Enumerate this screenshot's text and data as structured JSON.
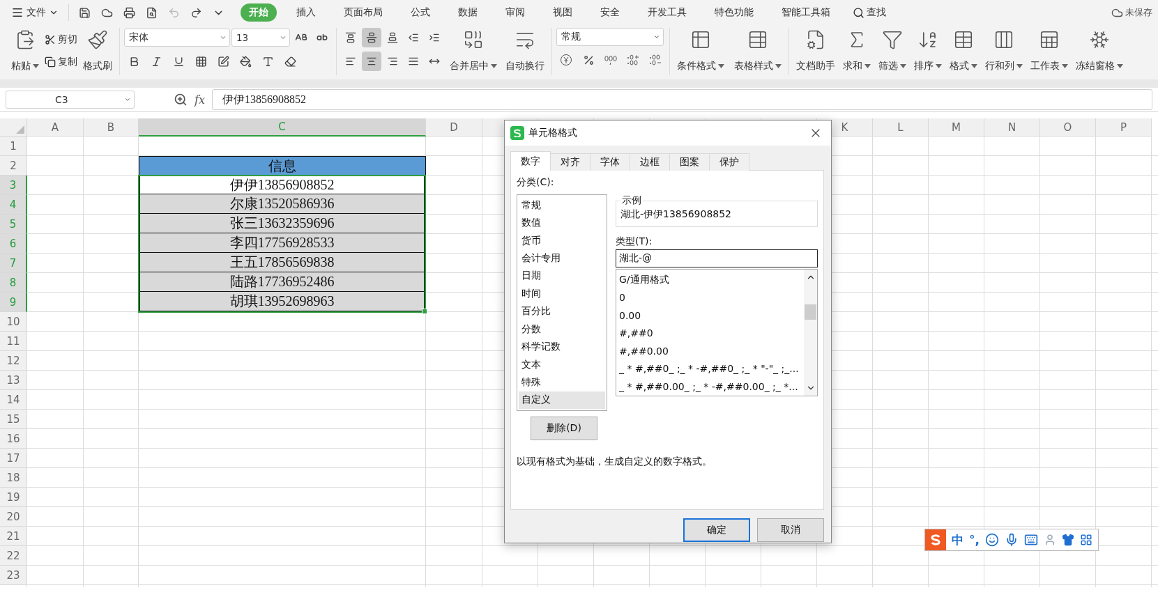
{
  "menu_bar": {
    "file_menu": "文件",
    "tabs": [
      {
        "label": "开始",
        "selected": true
      },
      {
        "label": "插入",
        "selected": false
      },
      {
        "label": "页面布局",
        "selected": false
      },
      {
        "label": "公式",
        "selected": false
      },
      {
        "label": "数据",
        "selected": false
      },
      {
        "label": "审阅",
        "selected": false
      },
      {
        "label": "视图",
        "selected": false
      },
      {
        "label": "安全",
        "selected": false
      },
      {
        "label": "开发工具",
        "selected": false
      },
      {
        "label": "特色功能",
        "selected": false
      },
      {
        "label": "智能工具箱",
        "selected": false
      }
    ],
    "search": "查找",
    "save_status": "未保存"
  },
  "ribbon": {
    "clipboard": [
      {
        "label": "粘贴",
        "kind": "large",
        "dropdown": true
      },
      {
        "label": "剪切",
        "kind": "small"
      },
      {
        "label": "复制",
        "kind": "small"
      },
      {
        "label": "格式刷",
        "kind": "large",
        "dropdown": false
      }
    ],
    "font_name": "宋体",
    "font_size": "13",
    "align_buttons": [
      {
        "selected": false
      },
      {
        "selected": true
      },
      {
        "selected": false
      },
      {
        "selected": false
      },
      {
        "selected": false
      },
      {
        "selected": false
      },
      {
        "selected": true
      },
      {
        "selected": false
      },
      {
        "selected": false
      },
      {
        "selected": false
      }
    ],
    "wrap_buttons": [
      {
        "label": "合并居中",
        "dropdown": true
      },
      {
        "label": "自动换行",
        "dropdown": false
      }
    ],
    "number_format": "常规",
    "style_buttons": [
      {
        "label": "条件格式",
        "dropdown": true
      },
      {
        "label": "表格样式",
        "dropdown": true
      }
    ],
    "tool_buttons": [
      {
        "label": "文档助手",
        "dropdown": false
      },
      {
        "label": "求和",
        "dropdown": true
      },
      {
        "label": "筛选",
        "dropdown": true
      },
      {
        "label": "排序",
        "dropdown": true
      },
      {
        "label": "格式",
        "dropdown": true
      },
      {
        "label": "行和列",
        "dropdown": true
      },
      {
        "label": "工作表",
        "dropdown": true
      },
      {
        "label": "冻结窗格",
        "dropdown": true
      }
    ]
  },
  "formula_bar": {
    "name_box": "C3",
    "fx": "fx",
    "value": "伊伊13856908852"
  },
  "sheet": {
    "columns_left": [
      {
        "label": "A",
        "selected": false
      },
      {
        "label": "B",
        "selected": false
      },
      {
        "label": "C",
        "selected": true
      },
      {
        "label": "D",
        "selected": false
      }
    ],
    "columns_right": [
      {
        "label": "K",
        "selected": false
      },
      {
        "label": "L",
        "selected": false
      },
      {
        "label": "M",
        "selected": false
      },
      {
        "label": "N",
        "selected": false
      },
      {
        "label": "O",
        "selected": false
      },
      {
        "label": "P",
        "selected": false
      }
    ],
    "rows": [
      {
        "label": "1",
        "selected": false
      },
      {
        "label": "2",
        "selected": false
      },
      {
        "label": "3",
        "selected": true
      },
      {
        "label": "4",
        "selected": true
      },
      {
        "label": "5",
        "selected": true
      },
      {
        "label": "6",
        "selected": true
      },
      {
        "label": "7",
        "selected": true
      },
      {
        "label": "8",
        "selected": true
      },
      {
        "label": "9",
        "selected": true
      },
      {
        "label": "10",
        "selected": false
      },
      {
        "label": "11",
        "selected": false
      },
      {
        "label": "12",
        "selected": false
      },
      {
        "label": "13",
        "selected": false
      },
      {
        "label": "14",
        "selected": false
      },
      {
        "label": "15",
        "selected": false
      },
      {
        "label": "16",
        "selected": false
      },
      {
        "label": "17",
        "selected": false
      },
      {
        "label": "18",
        "selected": false
      },
      {
        "label": "19",
        "selected": false
      },
      {
        "label": "20",
        "selected": false
      },
      {
        "label": "21",
        "selected": false
      },
      {
        "label": "22",
        "selected": false
      },
      {
        "label": "23",
        "selected": false
      }
    ],
    "table_header": "信息",
    "table_rows": [
      {
        "text": "伊伊13856908852",
        "active": true
      },
      {
        "text": "尔康13520586936",
        "active": false
      },
      {
        "text": "张三13632359696",
        "active": false
      },
      {
        "text": "李四17756928533",
        "active": false
      },
      {
        "text": "王五17856569838",
        "active": false
      },
      {
        "text": "陆路17736952486",
        "active": false
      },
      {
        "text": "胡琪13952698963",
        "active": false
      }
    ]
  },
  "dialog": {
    "title": "单元格格式",
    "tabs": [
      {
        "label": "数字",
        "selected": true
      },
      {
        "label": "对齐",
        "selected": false
      },
      {
        "label": "字体",
        "selected": false
      },
      {
        "label": "边框",
        "selected": false
      },
      {
        "label": "图案",
        "selected": false
      },
      {
        "label": "保护",
        "selected": false
      }
    ],
    "category_label": "分类(C):",
    "categories": [
      {
        "label": "常规",
        "selected": false
      },
      {
        "label": "数值",
        "selected": false
      },
      {
        "label": "货币",
        "selected": false
      },
      {
        "label": "会计专用",
        "selected": false
      },
      {
        "label": "日期",
        "selected": false
      },
      {
        "label": "时间",
        "selected": false
      },
      {
        "label": "百分比",
        "selected": false
      },
      {
        "label": "分数",
        "selected": false
      },
      {
        "label": "科学记数",
        "selected": false
      },
      {
        "label": "文本",
        "selected": false
      },
      {
        "label": "特殊",
        "selected": false
      },
      {
        "label": "自定义",
        "selected": true
      }
    ],
    "sample_label": "示例",
    "sample": "湖北-伊伊13856908852",
    "type_label": "类型(T):",
    "type_value": "湖北-@",
    "formats": [
      "G/通用格式",
      "0",
      "0.00",
      "#,##0",
      "#,##0.00",
      "_ * #,##0_ ;_ * -#,##0_ ;_ * \"-\"_ ;_...",
      "_ * #,##0.00_ ;_ * -#,##0.00_ ;_ *..."
    ],
    "delete_button": "删除(D)",
    "description": "以现有格式为基础，生成自定义的数字格式。",
    "ok_button": "确定",
    "cancel_button": "取消"
  },
  "ime_bar": {
    "mode": "中",
    "punctuation": "°,"
  }
}
